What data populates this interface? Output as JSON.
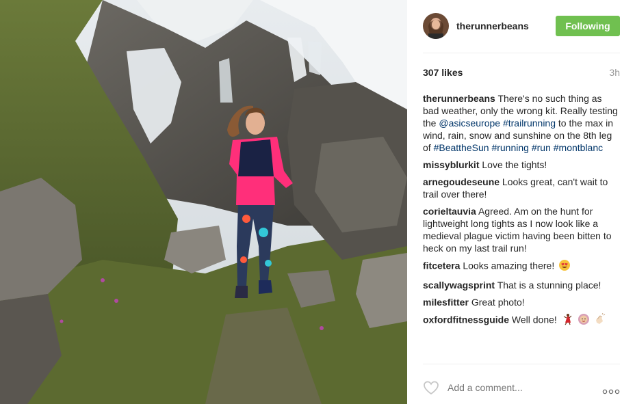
{
  "post": {
    "username": "therunnerbeans",
    "follow_label": "Following",
    "likes": "307 likes",
    "time": "3h"
  },
  "caption": {
    "user": "therunnerbeans",
    "t1": "There's no such thing as bad weather, only the wrong kit. Really testing the",
    "mention": "@asicseurope",
    "tag1": "#trailrunning",
    "t2": "to the max in wind, rain, snow and sunshine on the 8th leg of",
    "tag2": "#BeattheSun",
    "tag3": "#running",
    "tag4": "#run",
    "tag5": "#montblanc"
  },
  "comments": [
    {
      "user": "missyblurkit",
      "text": "Love the tights!"
    },
    {
      "user": "arnegoudeseune",
      "text": "Looks great, can't wait to trail over there!"
    },
    {
      "user": "corieltauvia",
      "text": "Agreed. Am on the hunt for lightweight long tights as I now look like a medieval plague victim having been bitten to heck on my last trail run!"
    },
    {
      "user": "fitcetera",
      "text": "Looks amazing there!"
    },
    {
      "user": "scallywagsprint",
      "text": "That is a stunning place!"
    },
    {
      "user": "milesfitter",
      "text": "Great photo!"
    },
    {
      "user": "oxfordfitnessguide",
      "text": "Well done!"
    }
  ],
  "add_comment": {
    "placeholder": "Add a comment..."
  },
  "colors": {
    "follow_green": "#70c050",
    "hashtag_blue": "#003569",
    "muted_gray": "#999999"
  },
  "icons": [
    "heart-icon",
    "more-options-icon",
    "heart-eyes-emoji",
    "dancer-emoji",
    "woman-emoji",
    "clap-emoji"
  ]
}
